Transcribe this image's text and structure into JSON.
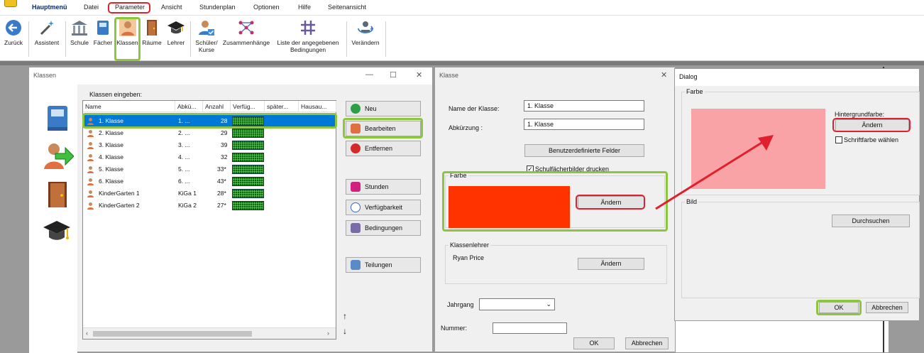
{
  "menubar": {
    "items": [
      "Hauptmenü",
      "Datei",
      "Parameter",
      "Ansicht",
      "Stundenplan",
      "Optionen",
      "Hilfe",
      "Seitenansicht"
    ]
  },
  "toolbar": {
    "back": "Zurück",
    "wizard": "Assistent",
    "school": "Schule",
    "subjects": "Fächer",
    "classes": "Klassen",
    "rooms": "Räume",
    "teachers": "Lehrer",
    "students_l1": "Schüler/",
    "students_l2": "Kurse",
    "relations": "Zusammenhänge",
    "conditions_l1": "Liste der angegebenen",
    "conditions_l2": "Bedingungen",
    "change": "Verändern"
  },
  "classes_window": {
    "title": "Klassen",
    "list_label": "Klassen eingeben:",
    "columns": [
      "Name",
      "Abkü...",
      "Anzahl",
      "Verfüg...",
      "später...",
      "Hausau..."
    ],
    "rows": [
      {
        "name": "1. Klasse",
        "abbr": "1. ...",
        "count": "28"
      },
      {
        "name": "2. Klasse",
        "abbr": "2. ...",
        "count": "29"
      },
      {
        "name": "3. Klasse",
        "abbr": "3. ...",
        "count": "39"
      },
      {
        "name": "4. Klasse",
        "abbr": "4. ...",
        "count": "32"
      },
      {
        "name": "5. Klasse",
        "abbr": "5. ...",
        "count": "33*"
      },
      {
        "name": "6. Klasse",
        "abbr": "6. ...",
        "count": "43*"
      },
      {
        "name": "KinderGarten 1",
        "abbr": "KiGa 1",
        "count": "28*"
      },
      {
        "name": "KinderGarten 2",
        "abbr": "KiGa 2",
        "count": "27*"
      }
    ],
    "buttons": {
      "new": "Neu",
      "edit": "Bearbeiten",
      "remove": "Entfernen",
      "hours": "Stunden",
      "availability": "Verfügbarkeit",
      "conditions": "Bedingungen",
      "divisions": "Teilungen"
    },
    "arrows": {
      "up": "↑",
      "down": "↓"
    }
  },
  "class_dialog": {
    "title": "Klasse",
    "name_label": "Name der Klasse:",
    "name_value": "1. Klasse",
    "abbr_label": "Abkürzung :",
    "abbr_value": "1. Klasse",
    "custom_fields": "Benutzerdefinierte Felder",
    "print_checkbox": "Schulfächerbilder drucken",
    "color_group": "Farbe",
    "color_value": "#ff3300",
    "change_color": "Ändern",
    "teacher_group": "Klassenlehrer",
    "teacher_name": "Ryan Price",
    "change_teacher": "Ändern",
    "year_label": "Jahrgang",
    "number_label": "Nummer:",
    "ok": "OK",
    "cancel": "Abbrechen"
  },
  "color_dialog": {
    "title": "Dialog",
    "color_group": "Farbe",
    "preview_color": "#f9a3a6",
    "bg_label": "Hintergrundfarbe:",
    "change": "Ändern",
    "font_color_checkbox": "Schriftfarbe wählen",
    "image_group": "Bild",
    "browse": "Durchsuchen",
    "ok": "OK",
    "cancel": "Abbrechen"
  },
  "colors": {
    "highlight_green": "#8cc63f",
    "highlight_red": "#e0202c",
    "selection": "#0078d7"
  }
}
